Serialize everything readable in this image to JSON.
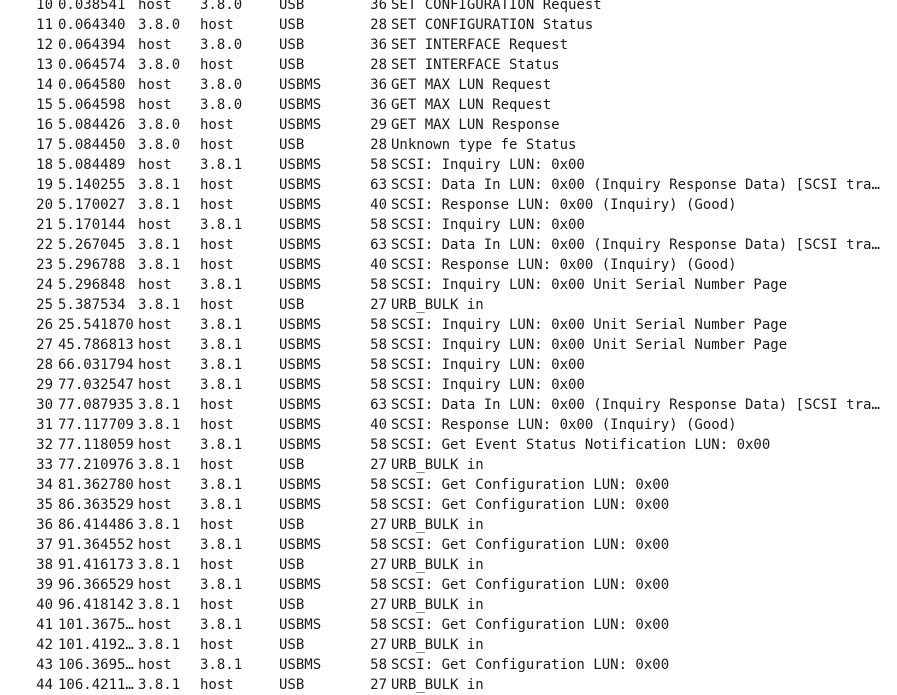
{
  "packets": [
    {
      "no": "10",
      "time": "0.038541",
      "src": "host",
      "dst": "3.8.0",
      "proto": "USB",
      "len": "36",
      "info": "SET CONFIGURATION Request"
    },
    {
      "no": "11",
      "time": "0.064340",
      "src": "3.8.0",
      "dst": "host",
      "proto": "USB",
      "len": "28",
      "info": "SET CONFIGURATION Status"
    },
    {
      "no": "12",
      "time": "0.064394",
      "src": "host",
      "dst": "3.8.0",
      "proto": "USB",
      "len": "36",
      "info": "SET INTERFACE Request"
    },
    {
      "no": "13",
      "time": "0.064574",
      "src": "3.8.0",
      "dst": "host",
      "proto": "USB",
      "len": "28",
      "info": "SET INTERFACE Status"
    },
    {
      "no": "14",
      "time": "0.064580",
      "src": "host",
      "dst": "3.8.0",
      "proto": "USBMS",
      "len": "36",
      "info": "GET MAX LUN Request"
    },
    {
      "no": "15",
      "time": "5.064598",
      "src": "host",
      "dst": "3.8.0",
      "proto": "USBMS",
      "len": "36",
      "info": "GET MAX LUN Request"
    },
    {
      "no": "16",
      "time": "5.084426",
      "src": "3.8.0",
      "dst": "host",
      "proto": "USBMS",
      "len": "29",
      "info": "GET MAX LUN Response"
    },
    {
      "no": "17",
      "time": "5.084450",
      "src": "3.8.0",
      "dst": "host",
      "proto": "USB",
      "len": "28",
      "info": "Unknown type fe Status"
    },
    {
      "no": "18",
      "time": "5.084489",
      "src": "host",
      "dst": "3.8.1",
      "proto": "USBMS",
      "len": "58",
      "info": "SCSI: Inquiry LUN: 0x00"
    },
    {
      "no": "19",
      "time": "5.140255",
      "src": "3.8.1",
      "dst": "host",
      "proto": "USBMS",
      "len": "63",
      "info": "SCSI: Data In LUN: 0x00 (Inquiry Response Data) [SCSI transfe…"
    },
    {
      "no": "20",
      "time": "5.170027",
      "src": "3.8.1",
      "dst": "host",
      "proto": "USBMS",
      "len": "40",
      "info": "SCSI: Response LUN: 0x00 (Inquiry) (Good)"
    },
    {
      "no": "21",
      "time": "5.170144",
      "src": "host",
      "dst": "3.8.1",
      "proto": "USBMS",
      "len": "58",
      "info": "SCSI: Inquiry LUN: 0x00"
    },
    {
      "no": "22",
      "time": "5.267045",
      "src": "3.8.1",
      "dst": "host",
      "proto": "USBMS",
      "len": "63",
      "info": "SCSI: Data In LUN: 0x00 (Inquiry Response Data) [SCSI transfe…"
    },
    {
      "no": "23",
      "time": "5.296788",
      "src": "3.8.1",
      "dst": "host",
      "proto": "USBMS",
      "len": "40",
      "info": "SCSI: Response LUN: 0x00 (Inquiry) (Good)"
    },
    {
      "no": "24",
      "time": "5.296848",
      "src": "host",
      "dst": "3.8.1",
      "proto": "USBMS",
      "len": "58",
      "info": "SCSI: Inquiry LUN: 0x00  Unit Serial Number Page"
    },
    {
      "no": "25",
      "time": "5.387534",
      "src": "3.8.1",
      "dst": "host",
      "proto": "USB",
      "len": "27",
      "info": "URB_BULK in"
    },
    {
      "no": "26",
      "time": "25.541870",
      "src": "host",
      "dst": "3.8.1",
      "proto": "USBMS",
      "len": "58",
      "info": "SCSI: Inquiry LUN: 0x00  Unit Serial Number Page"
    },
    {
      "no": "27",
      "time": "45.786813",
      "src": "host",
      "dst": "3.8.1",
      "proto": "USBMS",
      "len": "58",
      "info": "SCSI: Inquiry LUN: 0x00  Unit Serial Number Page"
    },
    {
      "no": "28",
      "time": "66.031794",
      "src": "host",
      "dst": "3.8.1",
      "proto": "USBMS",
      "len": "58",
      "info": "SCSI: Inquiry LUN: 0x00"
    },
    {
      "no": "29",
      "time": "77.032547",
      "src": "host",
      "dst": "3.8.1",
      "proto": "USBMS",
      "len": "58",
      "info": "SCSI: Inquiry LUN: 0x00"
    },
    {
      "no": "30",
      "time": "77.087935",
      "src": "3.8.1",
      "dst": "host",
      "proto": "USBMS",
      "len": "63",
      "info": "SCSI: Data In LUN: 0x00 (Inquiry Response Data) [SCSI transfe…"
    },
    {
      "no": "31",
      "time": "77.117709",
      "src": "3.8.1",
      "dst": "host",
      "proto": "USBMS",
      "len": "40",
      "info": "SCSI: Response LUN: 0x00 (Inquiry) (Good)"
    },
    {
      "no": "32",
      "time": "77.118059",
      "src": "host",
      "dst": "3.8.1",
      "proto": "USBMS",
      "len": "58",
      "info": "SCSI: Get Event Status Notification LUN: 0x00"
    },
    {
      "no": "33",
      "time": "77.210976",
      "src": "3.8.1",
      "dst": "host",
      "proto": "USB",
      "len": "27",
      "info": "URB_BULK in"
    },
    {
      "no": "34",
      "time": "81.362780",
      "src": "host",
      "dst": "3.8.1",
      "proto": "USBMS",
      "len": "58",
      "info": "SCSI: Get Configuration LUN: 0x00"
    },
    {
      "no": "35",
      "time": "86.363529",
      "src": "host",
      "dst": "3.8.1",
      "proto": "USBMS",
      "len": "58",
      "info": "SCSI: Get Configuration LUN: 0x00"
    },
    {
      "no": "36",
      "time": "86.414486",
      "src": "3.8.1",
      "dst": "host",
      "proto": "USB",
      "len": "27",
      "info": "URB_BULK in"
    },
    {
      "no": "37",
      "time": "91.364552",
      "src": "host",
      "dst": "3.8.1",
      "proto": "USBMS",
      "len": "58",
      "info": "SCSI: Get Configuration LUN: 0x00"
    },
    {
      "no": "38",
      "time": "91.416173",
      "src": "3.8.1",
      "dst": "host",
      "proto": "USB",
      "len": "27",
      "info": "URB_BULK in"
    },
    {
      "no": "39",
      "time": "96.366529",
      "src": "host",
      "dst": "3.8.1",
      "proto": "USBMS",
      "len": "58",
      "info": "SCSI: Get Configuration LUN: 0x00"
    },
    {
      "no": "40",
      "time": "96.418142",
      "src": "3.8.1",
      "dst": "host",
      "proto": "USB",
      "len": "27",
      "info": "URB_BULK in"
    },
    {
      "no": "41",
      "time": "101.3675…",
      "src": "host",
      "dst": "3.8.1",
      "proto": "USBMS",
      "len": "58",
      "info": "SCSI: Get Configuration LUN: 0x00"
    },
    {
      "no": "42",
      "time": "101.4192…",
      "src": "3.8.1",
      "dst": "host",
      "proto": "USB",
      "len": "27",
      "info": "URB_BULK in"
    },
    {
      "no": "43",
      "time": "106.3695…",
      "src": "host",
      "dst": "3.8.1",
      "proto": "USBMS",
      "len": "58",
      "info": "SCSI: Get Configuration LUN: 0x00"
    },
    {
      "no": "44",
      "time": "106.4211…",
      "src": "3.8.1",
      "dst": "host",
      "proto": "USB",
      "len": "27",
      "info": "URB_BULK in"
    }
  ]
}
